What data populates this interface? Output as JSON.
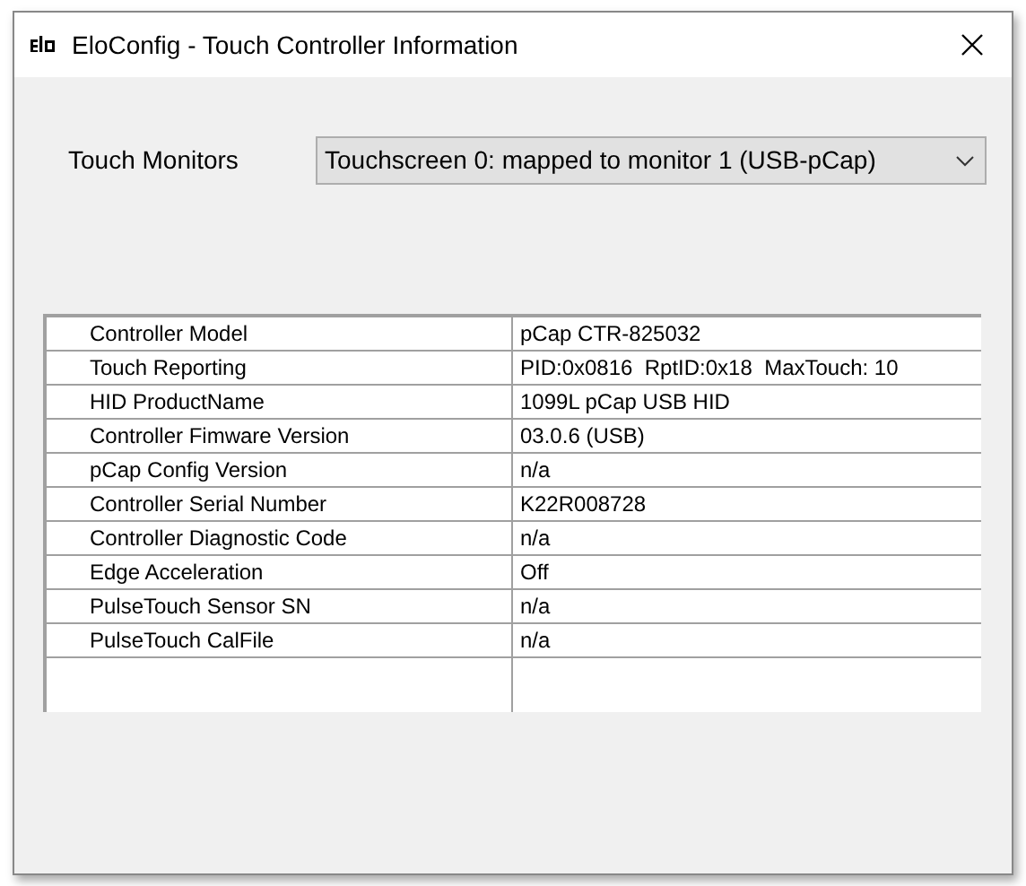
{
  "window": {
    "title": "EloConfig - Touch Controller Information"
  },
  "touch_monitors": {
    "label": "Touch Monitors",
    "value": "Touchscreen 0: mapped to monitor 1 (USB-pCap)"
  },
  "table": {
    "rows": [
      {
        "name": "Controller Model",
        "value": "pCap CTR-825032"
      },
      {
        "name": "Touch Reporting",
        "value": "PID:0x0816  RptID:0x18  MaxTouch: 10"
      },
      {
        "name": "HID ProductName",
        "value": "1099L pCap USB HID"
      },
      {
        "name": "Controller Fimware Version",
        "value": "03.0.6 (USB)"
      },
      {
        "name": "pCap Config Version",
        "value": "n/a"
      },
      {
        "name": "Controller Serial Number",
        "value": "K22R008728"
      },
      {
        "name": "Controller Diagnostic Code",
        "value": "n/a"
      },
      {
        "name": "Edge Acceleration",
        "value": "Off"
      },
      {
        "name": "PulseTouch Sensor SN",
        "value": "n/a"
      },
      {
        "name": "PulseTouch CalFile",
        "value": "n/a"
      }
    ]
  }
}
